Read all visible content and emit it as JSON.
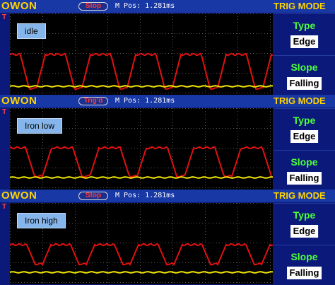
{
  "colors": {
    "header": "#1838a6",
    "brand": "#ffd400",
    "trace_red": "#e21010",
    "trace_yellow": "#f2e600",
    "side_title": "#4dff3a"
  },
  "panels": [
    {
      "brand": "OWON",
      "state": "Stop",
      "mpos": "M Pos: 1.281ms",
      "trig_title": "TRIG MODE",
      "label": "idle",
      "type_title": "Type",
      "type_value": "Edge",
      "slope_title": "Slope",
      "slope_value": "Falling",
      "marker": "T"
    },
    {
      "brand": "OWON",
      "state": "Trig'd",
      "mpos": "M Pos: 1.281ms",
      "trig_title": "TRIG MODE",
      "label": "Iron low",
      "type_title": "Type",
      "type_value": "Edge",
      "slope_title": "Slope",
      "slope_value": "Falling",
      "marker": "T"
    },
    {
      "brand": "OWON",
      "state": "Stop",
      "mpos": "M Pos: 1.281ms",
      "trig_title": "TRIG MODE",
      "label": "Iron high",
      "type_title": "Type",
      "type_value": "Edge",
      "slope_title": "Slope",
      "slope_value": "Falling",
      "marker": "T"
    }
  ]
}
